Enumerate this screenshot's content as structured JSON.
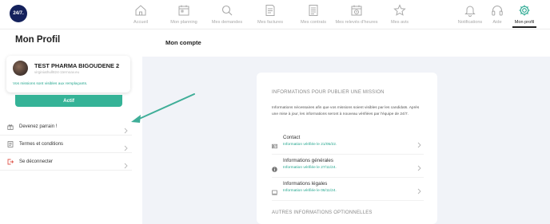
{
  "brand": {
    "logo_text": "24/7."
  },
  "nav": {
    "items": [
      {
        "label": "Accueil",
        "icon": "home-icon"
      },
      {
        "label": "Mon planning",
        "icon": "calendar-icon"
      },
      {
        "label": "Mes demandes",
        "icon": "search-icon"
      },
      {
        "label": "Mes factures",
        "icon": "invoice-icon"
      },
      {
        "label": "Mes contrats",
        "icon": "contract-icon"
      },
      {
        "label": "Mes relevés d'heures",
        "icon": "timesheet-icon"
      },
      {
        "label": "Mes avis",
        "icon": "star-icon"
      },
      {
        "label": "Notifications",
        "icon": "bell-icon"
      },
      {
        "label": "Aide",
        "icon": "headset-icon"
      },
      {
        "label": "Mon profil",
        "icon": "gear-icon",
        "active": true
      }
    ]
  },
  "sidebar": {
    "title": "Mon Profil",
    "profile": {
      "name": "TEST PHARMA BIGOUDENE 2",
      "email": "virginiathull824-1ternoav.eu",
      "note": "Vos missions sont visibles aux remplaçants."
    },
    "status_button": "Actif",
    "menu": [
      {
        "label": "Devenez parrain !",
        "icon": "gift-icon"
      },
      {
        "label": "Termes et conditions",
        "icon": "document-icon"
      },
      {
        "label": "Se déconnecter",
        "icon": "logout-icon"
      }
    ]
  },
  "main": {
    "title": "Mon compte",
    "section_title": "INFORMATIONS POUR PUBLIER UNE MISSION",
    "section_description": "Informations nécessaires afin que vos missions soient visibles par les candidats. Après une mise à jour, les informations seront à nouveau vérifiées par l'équipe de 24/7.",
    "rows": [
      {
        "title": "Contact",
        "status": "Information vérifiée le 21/05/22.",
        "icon": "contact-card-icon"
      },
      {
        "title": "Informations générales",
        "status": "Information vérifiée le 27/11/24.",
        "icon": "info-icon"
      },
      {
        "title": "Informations légales",
        "status": "Information vérifiée le 06/11/24.",
        "icon": "legal-icon"
      }
    ],
    "optional_title": "AUTRES INFORMATIONS OPTIONNELLES"
  },
  "colors": {
    "accent": "#35b397",
    "brand": "#14215c",
    "background": "#f1f3f8"
  }
}
